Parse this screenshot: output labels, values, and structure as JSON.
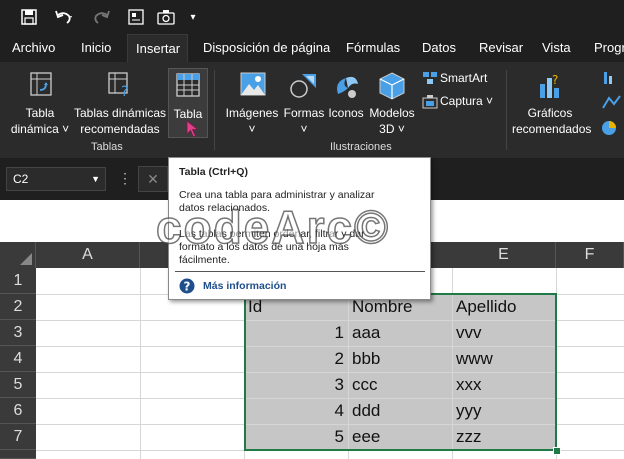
{
  "tabs": [
    "Archivo",
    "Inicio",
    "Insertar",
    "Disposición de página",
    "Fórmulas",
    "Datos",
    "Revisar",
    "Vista",
    "Progr"
  ],
  "ribbon": {
    "tabla_dinamica": [
      "Tabla",
      "dinámica ˅"
    ],
    "tablas_recomendadas": [
      "Tablas dinámicas",
      "recomendadas"
    ],
    "tabla": "Tabla",
    "imagenes": [
      "Imágenes",
      "˅"
    ],
    "formas": [
      "Formas",
      "˅"
    ],
    "iconos": "Iconos",
    "modelos": [
      "Modelos",
      "3D ˅"
    ],
    "smartart": "SmartArt",
    "captura": "Captura ˅",
    "graficos": [
      "Gráficos",
      "recomendados"
    ],
    "group_tablas": "Tablas",
    "group_ilustraciones": "Ilustraciones"
  },
  "namebox": "C2",
  "tooltip": {
    "title": "Tabla (Ctrl+Q)",
    "line1": "Crea una tabla para administrar y analizar",
    "line2": "datos relacionados.",
    "line3": "Las tablas permiten ordenar, filtrar y dar",
    "line4": "formato a los datos de una hoja más",
    "line5": "fácilmente.",
    "more": "Más información"
  },
  "watermark": "codeArc©",
  "columns": [
    "A",
    "E",
    "F"
  ],
  "rows": [
    "1",
    "2",
    "3",
    "4",
    "5",
    "6",
    "7"
  ],
  "table": {
    "headers": [
      "Id",
      "Nombre",
      "Apellido"
    ],
    "ids": [
      "1",
      "2",
      "3",
      "4",
      "5"
    ],
    "nombres": [
      "aaa",
      "bbb",
      "ccc",
      "ddd",
      "eee"
    ],
    "apellidos": [
      "vvv",
      "www",
      "xxx",
      "yyy",
      "zzz"
    ]
  }
}
